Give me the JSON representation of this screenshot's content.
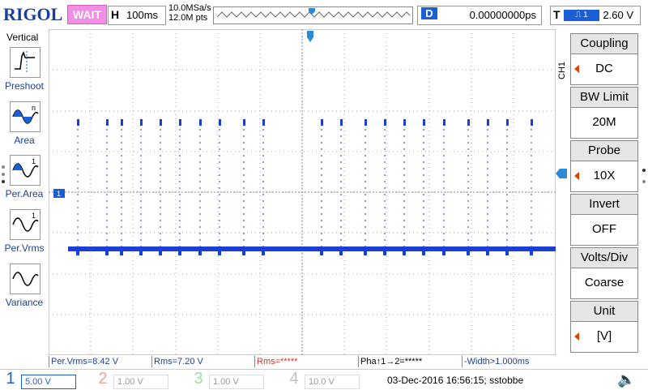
{
  "header": {
    "logo": "RIGOL",
    "status": "WAIT",
    "horizontal_label": "H",
    "horizontal_value": "100ms",
    "sample_rate": "10.0MSa/s",
    "memory_depth": "12.0M pts",
    "delay_label": "D",
    "delay_value": "0.00000000ps",
    "trigger_label": "T",
    "trigger_channel": "1",
    "trigger_value": "2.60 V"
  },
  "left_menu": {
    "title": "Vertical",
    "items": [
      {
        "label": "Preshoot",
        "icon": "preshoot-icon"
      },
      {
        "label": "Area",
        "icon": "area-icon"
      },
      {
        "label": "Per.Area",
        "icon": "per-area-icon"
      },
      {
        "label": "Per.Vrms",
        "icon": "per-vrms-icon"
      },
      {
        "label": "Variance",
        "icon": "variance-icon"
      }
    ]
  },
  "right_menu": {
    "channel_tag": "CH1",
    "buttons": [
      {
        "title": "Coupling",
        "value": "DC",
        "arrow": true
      },
      {
        "title": "BW Limit",
        "value": "20M",
        "arrow": false
      },
      {
        "title": "Probe",
        "value": "10X",
        "arrow": true
      },
      {
        "title": "Invert",
        "value": "OFF",
        "arrow": false
      },
      {
        "title": "Volts/Div",
        "value": "Coarse",
        "arrow": false
      },
      {
        "title": "Unit",
        "value": "[V]",
        "arrow": true
      }
    ]
  },
  "measurements": [
    {
      "text": "Per.Vrms=8.42 V",
      "color": "#1b3f9c"
    },
    {
      "text": "Rms=7.20 V",
      "color": "#1b3f9c"
    },
    {
      "text": "Rms=*****",
      "color": "#e03030"
    },
    {
      "text": "Pha↑1→2=*****",
      "color": "#000000"
    },
    {
      "text": "-Width>1.000ms",
      "color": "#1b3f9c"
    }
  ],
  "channels": [
    {
      "num": "1",
      "scale": "5.00 V",
      "color": "#1a5fd6",
      "active": true
    },
    {
      "num": "2",
      "scale": "1.00 V",
      "color": "#f0a0a0",
      "active": false
    },
    {
      "num": "3",
      "scale": "1.00 V",
      "color": "#a0e0a0",
      "active": false
    },
    {
      "num": "4",
      "scale": "10.0 V",
      "color": "#c0c0c0",
      "active": false
    }
  ],
  "footer": {
    "timestamp": "03-Dec-2016 16:56:15; sstobbe"
  },
  "waveform": {
    "color": "#1a3fd6",
    "channel_marker": "1",
    "pulse_fraction_columns": [
      0.02,
      0.08,
      0.11,
      0.15,
      0.19,
      0.23,
      0.27,
      0.31,
      0.36,
      0.4,
      0.52,
      0.56,
      0.61,
      0.65,
      0.69,
      0.73,
      0.77,
      0.82,
      0.86,
      0.9,
      0.95
    ]
  }
}
